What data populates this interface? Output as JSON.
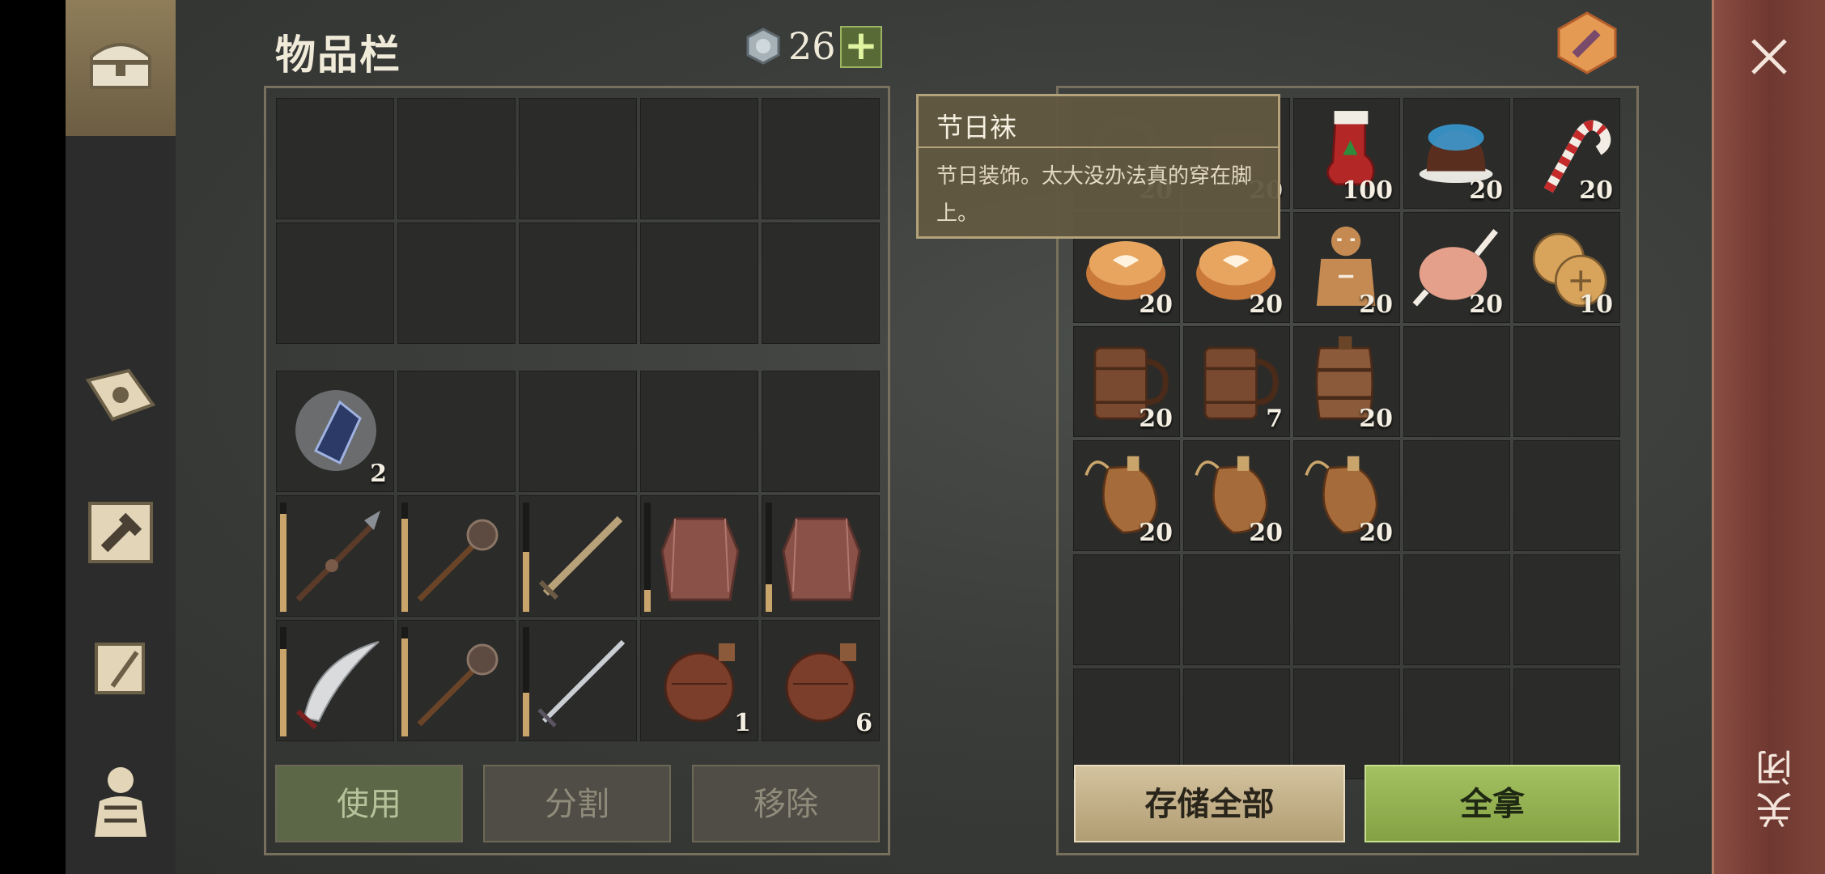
{
  "inventory": {
    "title": "物品栏",
    "coins": "26",
    "coin_plus": "+",
    "grid_top": [
      "",
      "",
      "",
      "",
      "",
      "",
      "",
      "",
      "",
      ""
    ],
    "grid_bottom": [
      {
        "icon": "crystal-icon",
        "qty": "2"
      },
      {
        "icon": "",
        "qty": ""
      },
      {
        "icon": "",
        "qty": ""
      },
      {
        "icon": "",
        "qty": ""
      },
      {
        "icon": "",
        "qty": ""
      },
      {
        "icon": "spear-icon",
        "qty": "",
        "durability": 0.9
      },
      {
        "icon": "mace-icon",
        "qty": "",
        "durability": 0.85
      },
      {
        "icon": "sword-icon",
        "qty": "",
        "durability": 0.55
      },
      {
        "icon": "chainmail-icon",
        "qty": "",
        "durability": 0.2
      },
      {
        "icon": "chainmail-icon",
        "qty": "",
        "durability": 0.25
      },
      {
        "icon": "scimitar-icon",
        "qty": "",
        "durability": 0.8
      },
      {
        "icon": "mace-icon",
        "qty": "",
        "durability": 0.9
      },
      {
        "icon": "longsword-icon",
        "qty": "",
        "durability": 0.4
      },
      {
        "icon": "flask-icon",
        "qty": "1"
      },
      {
        "icon": "flask-icon",
        "qty": "6"
      }
    ],
    "buttons": {
      "use": "使用",
      "split": "分割",
      "remove": "移除"
    }
  },
  "chest": {
    "items": [
      {
        "icon": "wreath-icon",
        "qty": "20"
      },
      {
        "icon": "gift-icon",
        "qty": "20"
      },
      {
        "icon": "stocking-icon",
        "qty": "100"
      },
      {
        "icon": "pudding-icon",
        "qty": "20"
      },
      {
        "icon": "candy-cane-icon",
        "qty": "20"
      },
      {
        "icon": "pie-icon",
        "qty": "20"
      },
      {
        "icon": "pie-icon",
        "qty": "20"
      },
      {
        "icon": "gingerbread-icon",
        "qty": "20"
      },
      {
        "icon": "roast-turkey-icon",
        "qty": "20"
      },
      {
        "icon": "cookies-icon",
        "qty": "10"
      },
      {
        "icon": "mug-icon",
        "qty": "20"
      },
      {
        "icon": "mug-icon",
        "qty": "7"
      },
      {
        "icon": "barrel-icon",
        "qty": "20"
      },
      {
        "icon": "",
        "qty": ""
      },
      {
        "icon": "",
        "qty": ""
      },
      {
        "icon": "waterskin-icon",
        "qty": "20"
      },
      {
        "icon": "waterskin-icon",
        "qty": "20"
      },
      {
        "icon": "waterskin-icon",
        "qty": "20"
      }
    ],
    "buttons": {
      "store_all": "存储全部",
      "take_all": "全拿"
    }
  },
  "tooltip": {
    "title": "节日袜",
    "description": "节日装饰。太大没办法真的穿在脚上。"
  },
  "close": {
    "label": "关闭"
  },
  "colors": {
    "accent_green": "#84a243",
    "panel_border": "#78705d",
    "close_strip": "#7d443a"
  }
}
